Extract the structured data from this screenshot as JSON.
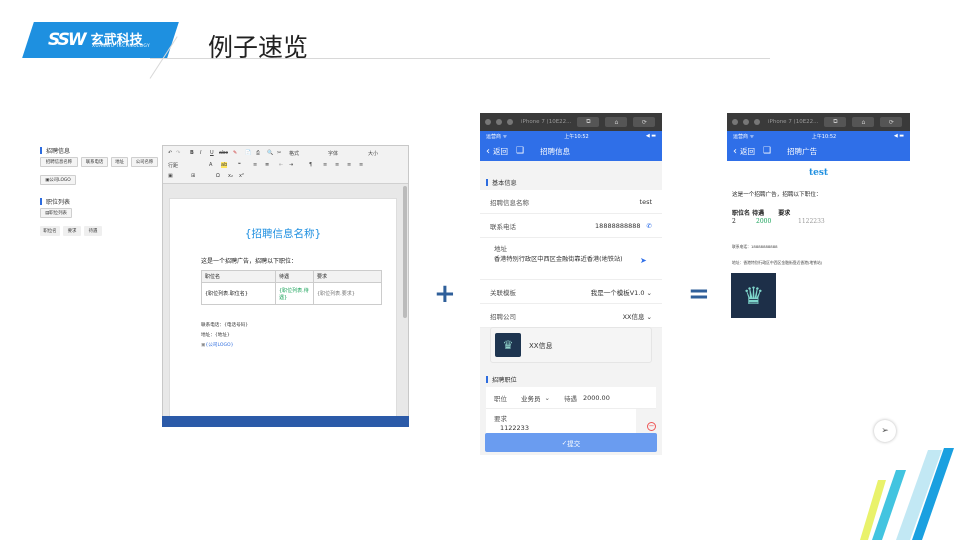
{
  "logo": {
    "mark": "SSW",
    "cn": "玄武科技",
    "en": "XUANWU TECHNOLOGY"
  },
  "title": "例子速览",
  "editor_panel": {
    "section1": "招聘信息",
    "chips1": [
      "招聘信息名称",
      "联系电话",
      "地址",
      "公司名称"
    ],
    "chip_logo": "公司LOGO",
    "section2": "职位列表",
    "chip_joblist": "职位列表",
    "chips2": [
      "职位名",
      "要求",
      "待遇"
    ],
    "toolbar": {
      "row1": [
        "↶",
        "↷",
        "B",
        "I",
        "U",
        "abc",
        "✎",
        "📄",
        "⎙",
        "🔍",
        "✂",
        "格式",
        "字体",
        "大小"
      ],
      "row2": [
        "行距",
        "A",
        "ab",
        "❝",
        "≡",
        "≣",
        "⇤",
        "⇥",
        "¶",
        "≡",
        "≡",
        "≡",
        "≡"
      ],
      "row3": [
        "▣",
        "⊞",
        "Ω",
        "x₂",
        "x²"
      ],
      "format": "格式",
      "font": "字体",
      "size": "大小",
      "line": "行距"
    },
    "doc": {
      "heading": "{招聘信息名称}",
      "intro": "这是一个招聘广告，招聘以下职位：",
      "table_head": [
        "职位名",
        "待遇",
        "要求"
      ],
      "table_row": [
        "{职位列表.职位名}",
        "{职位列表.待遇}",
        "{职位列表.要求}"
      ],
      "phone": "联系电话：{电话号码}",
      "address": "地址：{地址}",
      "logo": "{公司LOGO}"
    }
  },
  "ops": {
    "plus": "+",
    "equals": "="
  },
  "phone1": {
    "chrome_title": "iPhone 7 (10E22...",
    "carrier": "运营商 ᯤ",
    "time": "上午10:52",
    "battery": "◀ ▬",
    "back": "返回",
    "nav_title": "招聘信息",
    "section_basic": "基本信息",
    "rows": [
      {
        "label": "招聘信息名称",
        "value": "test"
      },
      {
        "label": "联系电话",
        "value": "18888888888"
      }
    ],
    "address_label": "地址",
    "address_value": "香港特别行政区中西区金融街靠近香港(地铁站)",
    "template_label": "关联模板",
    "template_value": "我是一个模板V1.0",
    "company_label": "招聘公司",
    "company_value": "XX信息",
    "company_name": "XX信息",
    "section_jobs": "招聘职位",
    "job_label": "职位",
    "job_value": "业务员",
    "pay_label": "待遇",
    "pay_value": "2000.00",
    "req_label": "要求",
    "req_value": "1122233",
    "submit": "提交"
  },
  "phone2": {
    "chrome_title": "iPhone 7 (10E22...",
    "carrier": "运营商 ᯤ",
    "time": "上午10:52",
    "battery": "◀ ▬",
    "back": "返回",
    "nav_title": "招聘广告",
    "heading": "test",
    "intro": "这是一个招聘广告，招聘以下职位：",
    "table_head": [
      "职位名",
      "待遇",
      "要求"
    ],
    "table_row": [
      "2",
      "2000",
      "1122233"
    ],
    "phone": "联系电话：18888888888",
    "address": "地址：香港特别行政区中西区金融街靠近香港(地铁站)"
  },
  "colors": {
    "accent": "#2f6fe8",
    "logo_blue": "#1e90e0",
    "green": "#1aa35a"
  }
}
